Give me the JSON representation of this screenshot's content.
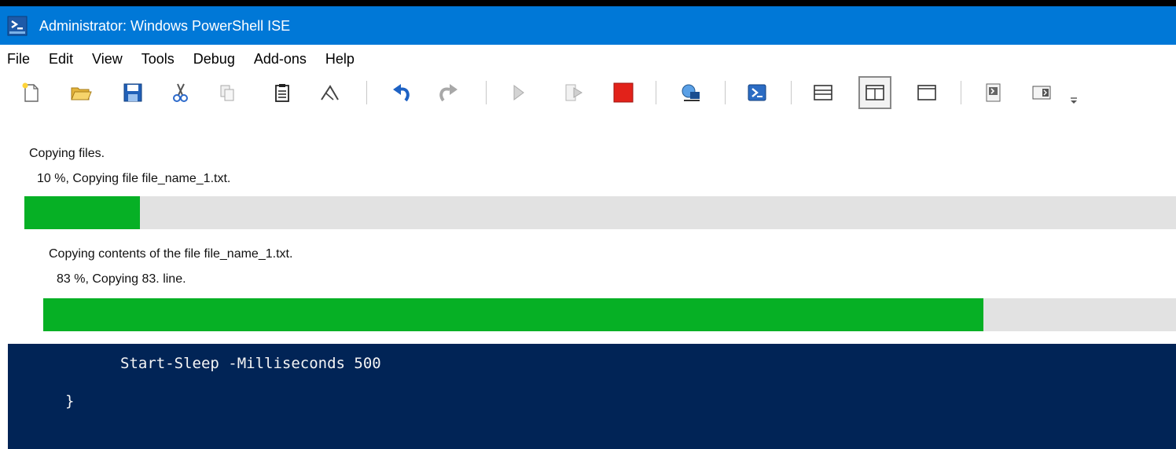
{
  "window": {
    "title": "Administrator: Windows PowerShell ISE",
    "accent_color": "#0078d7"
  },
  "menu": {
    "items": [
      "File",
      "Edit",
      "View",
      "Tools",
      "Debug",
      "Add-ons",
      "Help"
    ]
  },
  "toolbar": {
    "buttons": [
      {
        "icon": "new-file-icon"
      },
      {
        "icon": "open-folder-icon"
      },
      {
        "icon": "save-icon"
      },
      {
        "icon": "cut-icon"
      },
      {
        "icon": "copy-icon"
      },
      {
        "icon": "paste-icon"
      },
      {
        "icon": "clear-console-icon"
      },
      {
        "icon": "undo-icon"
      },
      {
        "icon": "redo-icon"
      },
      {
        "icon": "run-script-icon"
      },
      {
        "icon": "run-selection-icon"
      },
      {
        "icon": "stop-icon"
      },
      {
        "icon": "remote-powershell-icon"
      },
      {
        "icon": "start-powershell-icon"
      },
      {
        "icon": "script-pane-top-icon"
      },
      {
        "icon": "script-pane-right-icon"
      },
      {
        "icon": "script-pane-maximized-icon"
      },
      {
        "icon": "show-script-pane-icon"
      },
      {
        "icon": "show-commands-addon-icon"
      },
      {
        "icon": "toolbar-overflow-icon"
      }
    ],
    "pressed_button": "script-pane-right-icon"
  },
  "progress": [
    {
      "activity": "Copying files.",
      "status": "10 %, Copying file file_name_1.txt.",
      "percent": 10,
      "color": "#06b025"
    },
    {
      "activity": "Copying contents of the file file_name_1.txt.",
      "status": "83 %, Copying 83. line.",
      "percent": 83,
      "color": "#06b025"
    }
  ],
  "console": {
    "background": "#012456",
    "lines": [
      "Start-Sleep -Milliseconds 500",
      "}"
    ]
  }
}
